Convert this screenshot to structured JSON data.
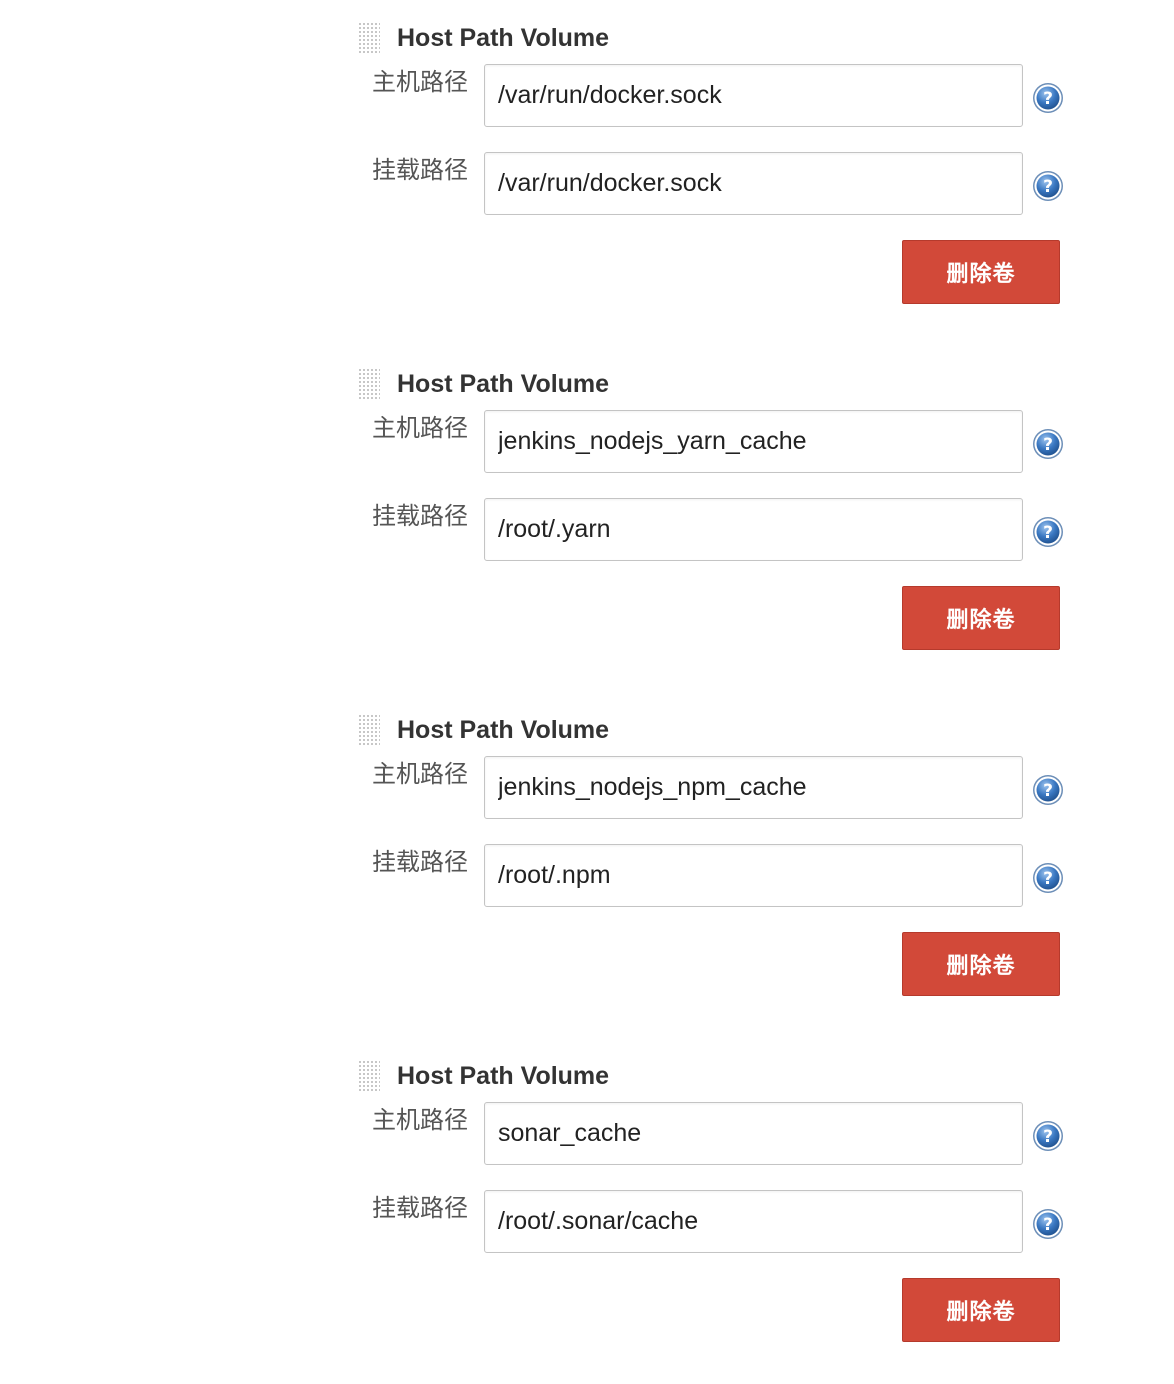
{
  "labels": {
    "host_path": "主机路径",
    "mount_path": "挂载路径",
    "delete_button": "删除卷"
  },
  "icons": {
    "drag_handle": "drag-handle-icon",
    "help": "help-icon"
  },
  "colors": {
    "delete_button_bg": "#d24939",
    "help_icon_blue": "#2f6db5"
  },
  "volumes": [
    {
      "title": "Host Path Volume",
      "host_path": "/var/run/docker.sock",
      "mount_path": "/var/run/docker.sock"
    },
    {
      "title": "Host Path Volume",
      "host_path": "jenkins_nodejs_yarn_cache",
      "mount_path": "/root/.yarn"
    },
    {
      "title": "Host Path Volume",
      "host_path": "jenkins_nodejs_npm_cache",
      "mount_path": "/root/.npm"
    },
    {
      "title": "Host Path Volume",
      "host_path": "sonar_cache",
      "mount_path": "/root/.sonar/cache"
    }
  ]
}
